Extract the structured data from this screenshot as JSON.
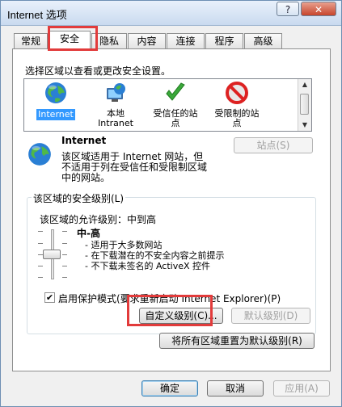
{
  "window": {
    "title": "Internet 选项",
    "help_label": "?",
    "close_label": "✕"
  },
  "tabs": [
    {
      "label": "常规"
    },
    {
      "label": "安全"
    },
    {
      "label": "隐私"
    },
    {
      "label": "内容"
    },
    {
      "label": "连接"
    },
    {
      "label": "程序"
    },
    {
      "label": "高级"
    }
  ],
  "active_tab": "安全",
  "security": {
    "zone_prompt": "选择区域以查看或更改安全设置。",
    "zones": [
      {
        "label": "Internet",
        "icon": "globe-icon"
      },
      {
        "label": "本地\nIntranet",
        "icon": "intranet-icon"
      },
      {
        "label": "受信任的站\n点",
        "icon": "check-icon"
      },
      {
        "label": "受限制的站\n点",
        "icon": "restricted-icon"
      }
    ],
    "selected_zone": "Internet",
    "zone_title": "Internet",
    "zone_desc_1": "该区域适用于 Internet 网站，但",
    "zone_desc_2": "不适用于列在受信任和受限制区域",
    "zone_desc_3": "中的网站。",
    "sites_button": "站点(S)",
    "level_group": "该区域的安全级别(L)",
    "allowed_level": "该区域的允许级别：中到高",
    "level_name": "中-高",
    "level_items": [
      "- 适用于大多数网站",
      "- 在下载潜在的不安全内容之前提示",
      "- 不下载未签名的 ActiveX 控件"
    ],
    "protected_mode_label": "启用保护模式(要求重新启动 Internet Explorer)(P)",
    "protected_mode_checked": true,
    "custom_button": "自定义级别(C)...",
    "default_button": "默认级别(D)",
    "reset_all_button": "将所有区域重置为默认级别(R)"
  },
  "footer": {
    "ok": "确定",
    "cancel": "取消",
    "apply": "应用(A)"
  },
  "colors": {
    "selection": "#3399ff",
    "highlight_box": "#e23b3b"
  }
}
